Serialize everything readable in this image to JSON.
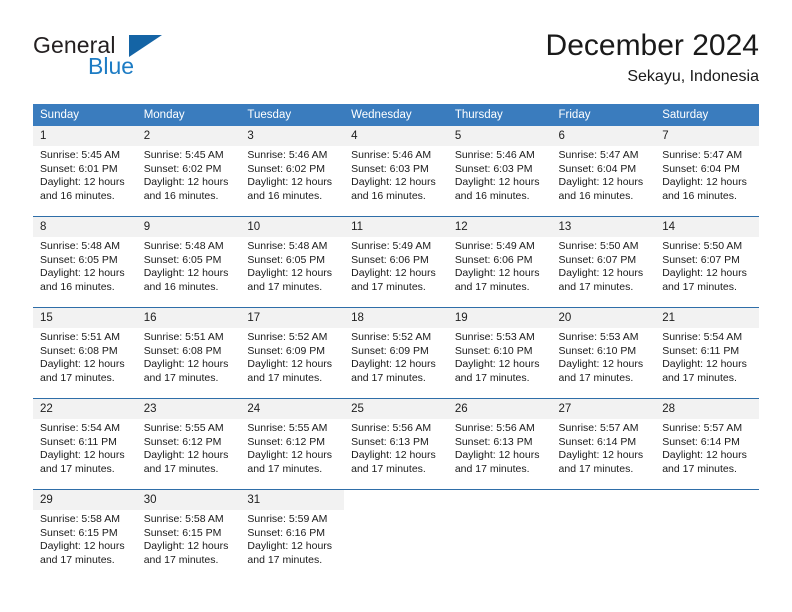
{
  "brand": {
    "name_primary": "General",
    "name_secondary": "Blue",
    "logo_icon": "triangle-logo-icon"
  },
  "header": {
    "title": "December 2024",
    "subtitle": "Sekayu, Indonesia"
  },
  "theme": {
    "header_blue": "#3a7cbe",
    "rule_blue": "#2f6ea8",
    "daynum_band": "#f2f2f2",
    "brand_blue": "#1d7cc4",
    "logo_blue": "#1464a5"
  },
  "weekdays": [
    "Sunday",
    "Monday",
    "Tuesday",
    "Wednesday",
    "Thursday",
    "Friday",
    "Saturday"
  ],
  "weeks": [
    [
      {
        "day": "1",
        "sunrise": "Sunrise: 5:45 AM",
        "sunset": "Sunset: 6:01 PM",
        "daylight": "Daylight: 12 hours and 16 minutes."
      },
      {
        "day": "2",
        "sunrise": "Sunrise: 5:45 AM",
        "sunset": "Sunset: 6:02 PM",
        "daylight": "Daylight: 12 hours and 16 minutes."
      },
      {
        "day": "3",
        "sunrise": "Sunrise: 5:46 AM",
        "sunset": "Sunset: 6:02 PM",
        "daylight": "Daylight: 12 hours and 16 minutes."
      },
      {
        "day": "4",
        "sunrise": "Sunrise: 5:46 AM",
        "sunset": "Sunset: 6:03 PM",
        "daylight": "Daylight: 12 hours and 16 minutes."
      },
      {
        "day": "5",
        "sunrise": "Sunrise: 5:46 AM",
        "sunset": "Sunset: 6:03 PM",
        "daylight": "Daylight: 12 hours and 16 minutes."
      },
      {
        "day": "6",
        "sunrise": "Sunrise: 5:47 AM",
        "sunset": "Sunset: 6:04 PM",
        "daylight": "Daylight: 12 hours and 16 minutes."
      },
      {
        "day": "7",
        "sunrise": "Sunrise: 5:47 AM",
        "sunset": "Sunset: 6:04 PM",
        "daylight": "Daylight: 12 hours and 16 minutes."
      }
    ],
    [
      {
        "day": "8",
        "sunrise": "Sunrise: 5:48 AM",
        "sunset": "Sunset: 6:05 PM",
        "daylight": "Daylight: 12 hours and 16 minutes."
      },
      {
        "day": "9",
        "sunrise": "Sunrise: 5:48 AM",
        "sunset": "Sunset: 6:05 PM",
        "daylight": "Daylight: 12 hours and 16 minutes."
      },
      {
        "day": "10",
        "sunrise": "Sunrise: 5:48 AM",
        "sunset": "Sunset: 6:05 PM",
        "daylight": "Daylight: 12 hours and 17 minutes."
      },
      {
        "day": "11",
        "sunrise": "Sunrise: 5:49 AM",
        "sunset": "Sunset: 6:06 PM",
        "daylight": "Daylight: 12 hours and 17 minutes."
      },
      {
        "day": "12",
        "sunrise": "Sunrise: 5:49 AM",
        "sunset": "Sunset: 6:06 PM",
        "daylight": "Daylight: 12 hours and 17 minutes."
      },
      {
        "day": "13",
        "sunrise": "Sunrise: 5:50 AM",
        "sunset": "Sunset: 6:07 PM",
        "daylight": "Daylight: 12 hours and 17 minutes."
      },
      {
        "day": "14",
        "sunrise": "Sunrise: 5:50 AM",
        "sunset": "Sunset: 6:07 PM",
        "daylight": "Daylight: 12 hours and 17 minutes."
      }
    ],
    [
      {
        "day": "15",
        "sunrise": "Sunrise: 5:51 AM",
        "sunset": "Sunset: 6:08 PM",
        "daylight": "Daylight: 12 hours and 17 minutes."
      },
      {
        "day": "16",
        "sunrise": "Sunrise: 5:51 AM",
        "sunset": "Sunset: 6:08 PM",
        "daylight": "Daylight: 12 hours and 17 minutes."
      },
      {
        "day": "17",
        "sunrise": "Sunrise: 5:52 AM",
        "sunset": "Sunset: 6:09 PM",
        "daylight": "Daylight: 12 hours and 17 minutes."
      },
      {
        "day": "18",
        "sunrise": "Sunrise: 5:52 AM",
        "sunset": "Sunset: 6:09 PM",
        "daylight": "Daylight: 12 hours and 17 minutes."
      },
      {
        "day": "19",
        "sunrise": "Sunrise: 5:53 AM",
        "sunset": "Sunset: 6:10 PM",
        "daylight": "Daylight: 12 hours and 17 minutes."
      },
      {
        "day": "20",
        "sunrise": "Sunrise: 5:53 AM",
        "sunset": "Sunset: 6:10 PM",
        "daylight": "Daylight: 12 hours and 17 minutes."
      },
      {
        "day": "21",
        "sunrise": "Sunrise: 5:54 AM",
        "sunset": "Sunset: 6:11 PM",
        "daylight": "Daylight: 12 hours and 17 minutes."
      }
    ],
    [
      {
        "day": "22",
        "sunrise": "Sunrise: 5:54 AM",
        "sunset": "Sunset: 6:11 PM",
        "daylight": "Daylight: 12 hours and 17 minutes."
      },
      {
        "day": "23",
        "sunrise": "Sunrise: 5:55 AM",
        "sunset": "Sunset: 6:12 PM",
        "daylight": "Daylight: 12 hours and 17 minutes."
      },
      {
        "day": "24",
        "sunrise": "Sunrise: 5:55 AM",
        "sunset": "Sunset: 6:12 PM",
        "daylight": "Daylight: 12 hours and 17 minutes."
      },
      {
        "day": "25",
        "sunrise": "Sunrise: 5:56 AM",
        "sunset": "Sunset: 6:13 PM",
        "daylight": "Daylight: 12 hours and 17 minutes."
      },
      {
        "day": "26",
        "sunrise": "Sunrise: 5:56 AM",
        "sunset": "Sunset: 6:13 PM",
        "daylight": "Daylight: 12 hours and 17 minutes."
      },
      {
        "day": "27",
        "sunrise": "Sunrise: 5:57 AM",
        "sunset": "Sunset: 6:14 PM",
        "daylight": "Daylight: 12 hours and 17 minutes."
      },
      {
        "day": "28",
        "sunrise": "Sunrise: 5:57 AM",
        "sunset": "Sunset: 6:14 PM",
        "daylight": "Daylight: 12 hours and 17 minutes."
      }
    ],
    [
      {
        "day": "29",
        "sunrise": "Sunrise: 5:58 AM",
        "sunset": "Sunset: 6:15 PM",
        "daylight": "Daylight: 12 hours and 17 minutes."
      },
      {
        "day": "30",
        "sunrise": "Sunrise: 5:58 AM",
        "sunset": "Sunset: 6:15 PM",
        "daylight": "Daylight: 12 hours and 17 minutes."
      },
      {
        "day": "31",
        "sunrise": "Sunrise: 5:59 AM",
        "sunset": "Sunset: 6:16 PM",
        "daylight": "Daylight: 12 hours and 17 minutes."
      },
      {
        "day": "",
        "sunrise": "",
        "sunset": "",
        "daylight": ""
      },
      {
        "day": "",
        "sunrise": "",
        "sunset": "",
        "daylight": ""
      },
      {
        "day": "",
        "sunrise": "",
        "sunset": "",
        "daylight": ""
      },
      {
        "day": "",
        "sunrise": "",
        "sunset": "",
        "daylight": ""
      }
    ]
  ]
}
